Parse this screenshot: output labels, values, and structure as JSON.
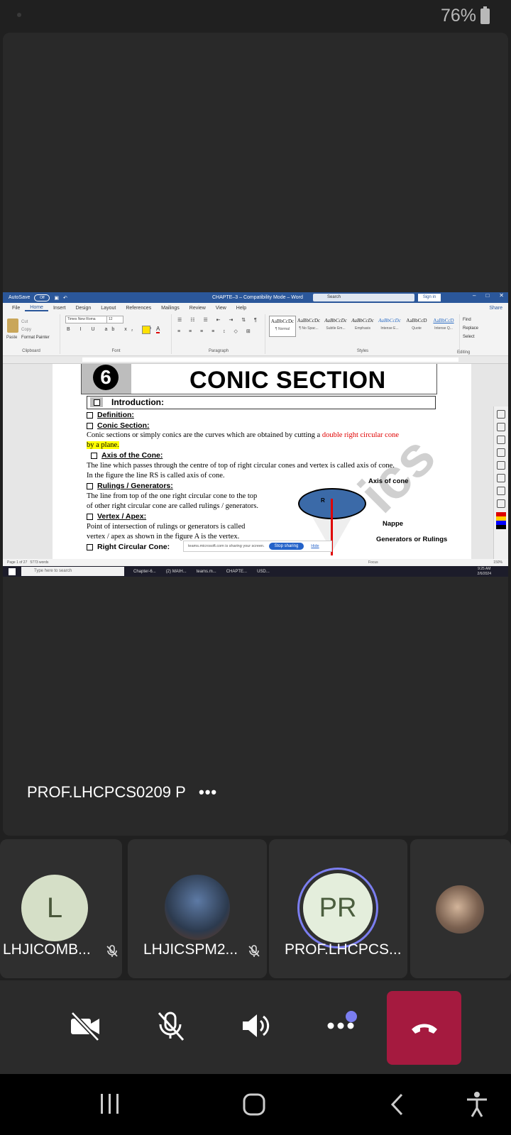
{
  "status": {
    "battery": "76%"
  },
  "word": {
    "title_bar": {
      "autosave": "AutoSave",
      "autosave_state": "Off",
      "doc_title": "CHAPTE–3 – Compatibility Mode – Word",
      "search_placeholder": "Search",
      "signin": "Sign in"
    },
    "tabs": [
      "File",
      "Home",
      "Insert",
      "Design",
      "Layout",
      "References",
      "Mailings",
      "Review",
      "View",
      "Help"
    ],
    "share": "Share",
    "ribbon": {
      "paste": "Paste",
      "cut": "Cut",
      "copy": "Copy",
      "format_painter": "Format Painter",
      "clipboard": "Clipboard",
      "font_name": "Times New Roma",
      "font_size": "12",
      "font": "Font",
      "paragraph": "Paragraph",
      "styles_label": "Styles",
      "editing": "Editing",
      "find": "Find",
      "replace": "Replace",
      "select": "Select",
      "styles": [
        {
          "sample": "AaBbCcDc",
          "name": "¶ Normal"
        },
        {
          "sample": "AaBbCcDc",
          "name": "¶ No Spac..."
        },
        {
          "sample": "AaBbCcDc",
          "name": "Subtle Em..."
        },
        {
          "sample": "AaBbCcDc",
          "name": "Emphasis"
        },
        {
          "sample": "AaBbCcDc",
          "name": "Intense E..."
        },
        {
          "sample": "AaBbCcD",
          "name": "Quote"
        },
        {
          "sample": "AaBbCcD",
          "name": "Intense Q..."
        }
      ]
    },
    "doc": {
      "chapter_num": "6",
      "chapter_title": "CONIC SECTION",
      "intro": "Introduction:",
      "definition": "Definition:",
      "conic_section": "Conic Section:",
      "conic_text_1": "Conic sections or simply conics are the curves which are obtained by cutting a ",
      "conic_text_red": "double right circular cone",
      "conic_text_hl": "by a plane.",
      "axis_head": "Axis of the Cone:",
      "axis_text_1": "The line which passes through the centre of top of right circular cones and vertex is called axis of cone.",
      "axis_text_2": " In the figure the line  RS  is called axis of cone.",
      "rulings_head": "Rulings / Generators:",
      "rulings_text_1": "The line from top of the one right circular cone to the top",
      "rulings_text_2": "of other right circular cone are called rulings / generators.",
      "vertex_head": "Vertex / Apex:",
      "vertex_text_1": "Point of intersection of rulings or generators is called",
      "vertex_text_2": "vertex / apex as shown in the figure A is the vertex.",
      "rcc_head": "Right Circular Cone:",
      "fig_axis": "Axis of cone",
      "fig_nappe": "Nappe",
      "fig_gen": "Generators or Rulings",
      "fig_R": "R"
    },
    "sharing": {
      "text": "teams.microsoft.com is sharing your screen.",
      "stop": "Stop sharing",
      "hide": "Hide"
    },
    "statusbar": {
      "page": "Page 1 of 27",
      "words": "5773 words",
      "focus": "Focus",
      "zoom": "150%"
    },
    "taskbar": {
      "search": "Type here to search",
      "items": [
        "Chapter-6...",
        "(2) MAIH...",
        "teams.m...",
        "CHAPTE..."
      ],
      "usd": "USD...",
      "time": "9:25 AM",
      "date": "2/6/2024"
    }
  },
  "meeting": {
    "presenter": "PROF.LHCPCS0209 P",
    "more": "•••",
    "participants": [
      {
        "initials": "L",
        "name": "LHJICOMB..."
      },
      {
        "initials": "",
        "name": "LHJICSPM2..."
      },
      {
        "initials": "PR",
        "name": "PROF.LHCPCS..."
      }
    ]
  }
}
